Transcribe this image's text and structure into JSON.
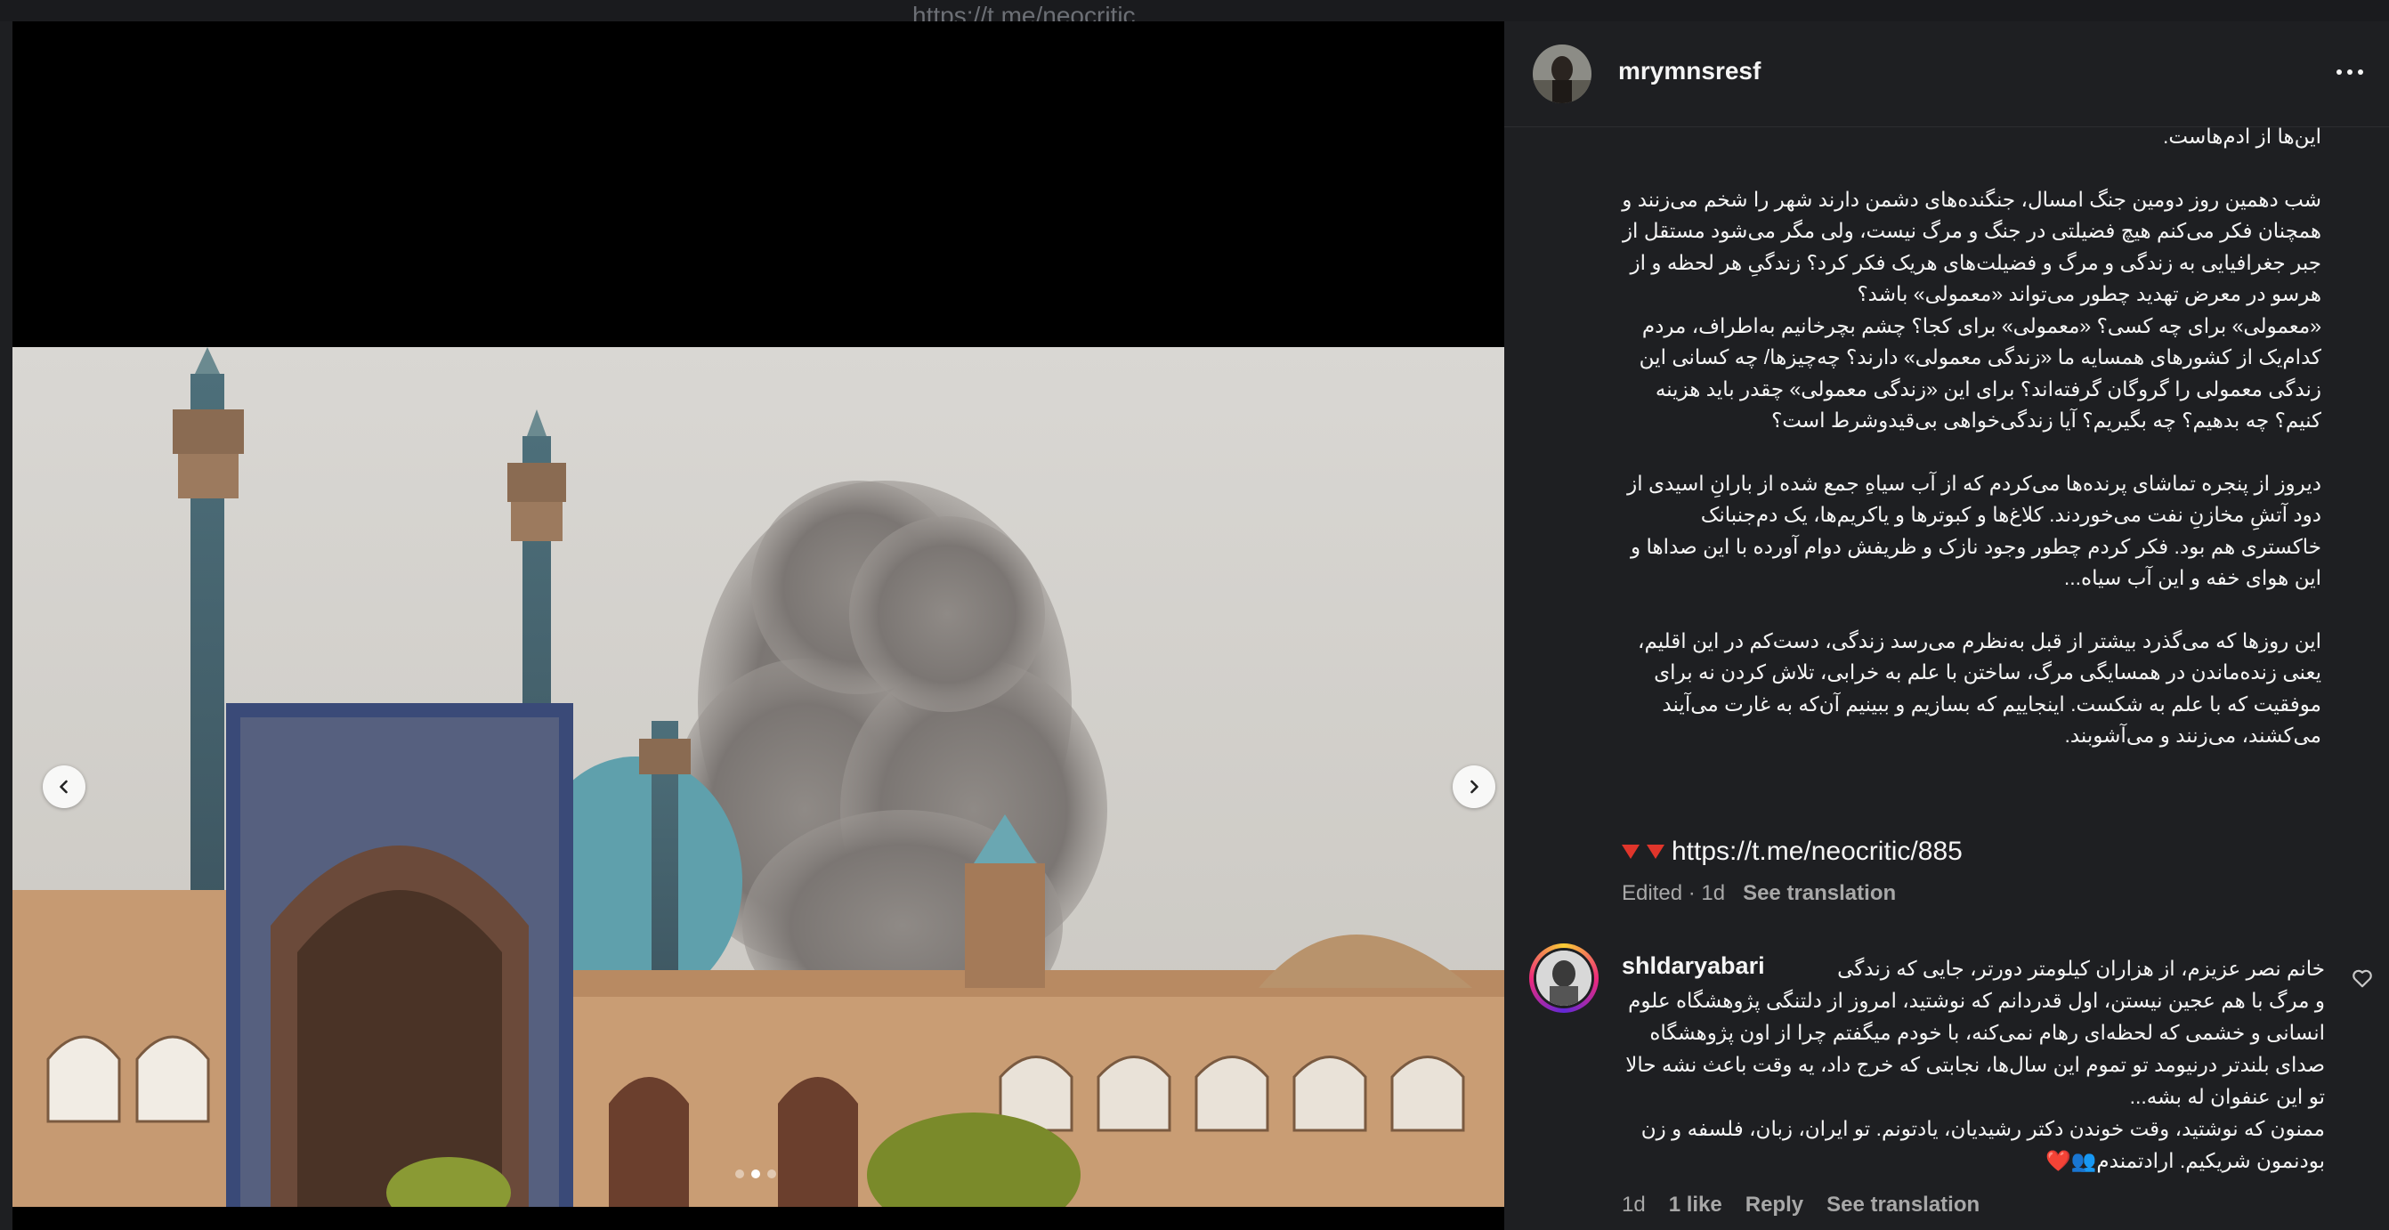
{
  "topstrip": {
    "url_text": "https://t.me/neocritic"
  },
  "media": {
    "prev_icon": "chevron-left-icon",
    "next_icon": "chevron-right-icon",
    "carousel_count": 3,
    "carousel_active": 2
  },
  "post": {
    "username": "mrymnsresf",
    "more_icon": "more-horizontal-icon",
    "caption_lines": [
      "این‌ها از آدم‌هاست.",
      "",
      "شب دهمین روز دومین جنگ امسال، جنگنده‌های دشمن دارند شهر را شخم می‌زنند و همچنان فکر می‌کنم هیچ فضیلتی در جنگ و مرگ نیست، ولی مگر می‌شود مستقل از جبر جغرافیایی به زندگی و مرگ و فضیلت‌های هریک فکر کرد؟ زندگیِ هر لحظه و از هرسو در معرض تهدید چطور می‌تواند «معمولی» باشد؟",
      "«معمولی» برای چه کسی؟ «معمولی» برای کجا؟ چشم بچرخانیم به‌اطراف، مردم کدام‌یک از کشورهای همسایه ما «زندگی معمولی» دارند؟ چه‌چیزها/ چه کسانی این زندگی معمولی را گروگان گرفته‌اند؟ برای این «زندگی معمولی» چقدر باید هزینه کنیم؟ چه بدهیم؟ چه بگیریم؟ آیا زندگی‌خواهی بی‌قیدوشرط است؟",
      "",
      "دیروز از پنجره تماشای پرنده‌ها می‌کردم که از آب سیاهِ جمع شده از بارانِ اسیدی از دود آتشِ مخازنِ نفت می‌خوردند. کلاغ‌ها و کبوترها و یاکریم‌ها، یک دم‌جنبانک خاکستری هم بود. فکر کردم چطور وجود نازک و ظریفش دوام آورده با این صداها و این هوای خفه و این آب سیاه...",
      "",
      "این روزها که می‌گذرد بیشتر از قبل به‌نظرم می‌رسد زندگی، دست‌کم در این اقلیم، یعنی زنده‌ماندن در همسایگی مرگ، ساختن با علم به خرابی، تلاش کردن نه برای موفقیت که با علم به شکست. اینجاییم که بسازیم و ببینیم آن‌که به غارت می‌آیند می‌کشند، می‌زنند و می‌آشوبند."
    ],
    "link_text": "https://t.me/neocritic/885",
    "edited_label": "Edited · 1d",
    "see_translation": "See translation"
  },
  "comment": {
    "username": "shldaryabari",
    "text_lines": [
      "خانم نصر عزیزم، از هزاران کیلومتر دورتر، جایی که زندگی و مرگ با هم عجین نیستن، اول قدردانم که نوشتید، امروز از دلتنگی پژوهشگاه علوم انسانی و خشمی که لحظه‌ای رهام نمی‌کنه، با خودم میگفتم چرا از اون پژوهشگاه صدای بلندتر درنیومد تو تموم این سال‌ها، نجابتی که خرج داد، یه وقت باعث نشه حالا تو این عنفوان له بشه...",
      "ممنون که نوشتید، وقت خوندن دکتر رشیدیان، یادتونم. تو ایران، زبان، فلسفه و زن بودنمون شریکیم. ارادتمندم👥❤️"
    ],
    "age": "1d",
    "likes": "1 like",
    "reply": "Reply",
    "see_translation": "See translation",
    "heart_icon": "heart-outline-icon"
  }
}
